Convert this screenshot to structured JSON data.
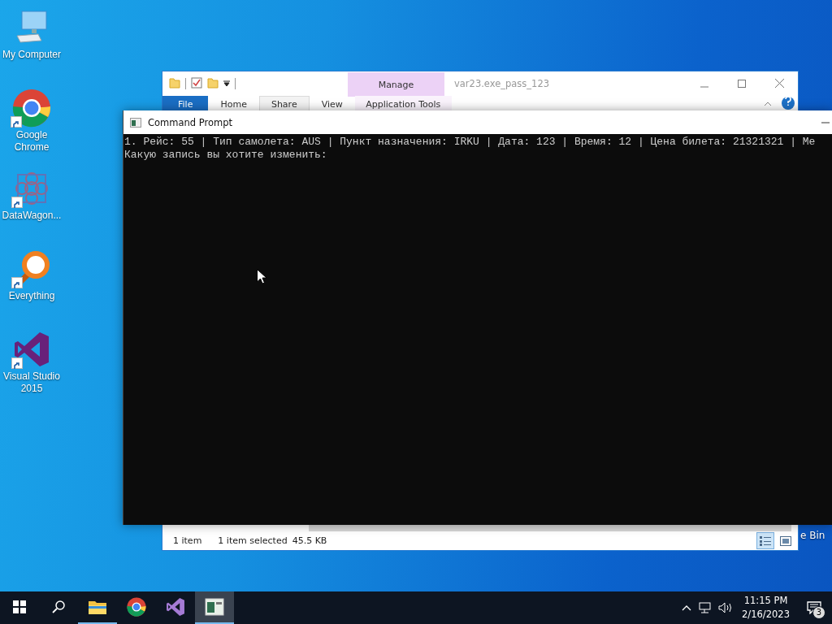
{
  "desktop": {
    "icons": [
      {
        "kind": "computer",
        "label": "My Computer",
        "shortcut": false
      },
      {
        "kind": "chrome",
        "label": "Google Chrome",
        "shortcut": true
      },
      {
        "kind": "datawagon",
        "label": "DataWagon...",
        "shortcut": true
      },
      {
        "kind": "everything",
        "label": "Everything",
        "shortcut": true
      },
      {
        "kind": "visualstudio",
        "label": "Visual Studio 2015",
        "shortcut": true
      }
    ],
    "partial_label": "e Bin"
  },
  "explorer": {
    "title": "var23.exe_pass_123",
    "context_group": "Manage",
    "ribbon_tabs": [
      {
        "label": "File",
        "kind": "file",
        "selected": false
      },
      {
        "label": "Home",
        "kind": "normal",
        "selected": false
      },
      {
        "label": "Share",
        "kind": "normal",
        "selected": true
      },
      {
        "label": "View",
        "kind": "normal",
        "selected": false
      },
      {
        "label": "Application Tools",
        "kind": "contextual",
        "selected": false
      }
    ],
    "status": {
      "item_count": "1 item",
      "selection": "1 item selected",
      "size": "45.5 KB"
    },
    "view_buttons": [
      {
        "kind": "details",
        "selected": true
      },
      {
        "kind": "large-icons",
        "selected": false
      }
    ]
  },
  "console": {
    "title": "Command Prompt",
    "lines": [
      "1. Рейс: 55 | Тип самолета: AUS | Пункт назначения: IRKU | Дата: 123 | Время: 12 | Цена билета: 21321321 | Ме",
      "Какую запись вы хотите изменить:"
    ]
  },
  "taskbar": {
    "apps": [
      {
        "kind": "explorer",
        "running": true,
        "selected": false
      },
      {
        "kind": "chrome",
        "running": false,
        "selected": false
      },
      {
        "kind": "visualstudio",
        "running": false,
        "selected": false
      },
      {
        "kind": "console",
        "running": true,
        "selected": true
      }
    ],
    "time": "11:15 PM",
    "date": "2/16/2023",
    "notifications": "3"
  }
}
